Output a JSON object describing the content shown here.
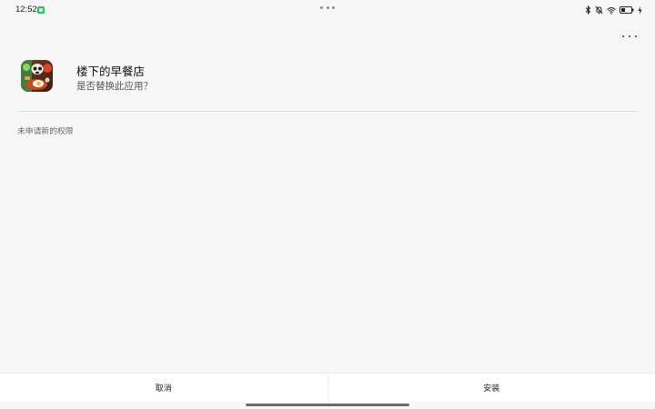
{
  "status_bar": {
    "time": "12:52",
    "notification_icon": "wechat-icon",
    "icons": [
      "bluetooth-icon",
      "mute-icon",
      "wifi-icon",
      "battery-icon",
      "charging-icon"
    ],
    "accent_color": "#22c55e"
  },
  "menu": {
    "icon": "more-options-icon"
  },
  "app": {
    "name": "楼下的早餐店",
    "question": "是否替换此应用？",
    "icon": "breakfast-shop-app-icon"
  },
  "permissions": {
    "note": "未申请新的权限"
  },
  "actions": {
    "cancel_label": "取消",
    "install_label": "安装"
  }
}
